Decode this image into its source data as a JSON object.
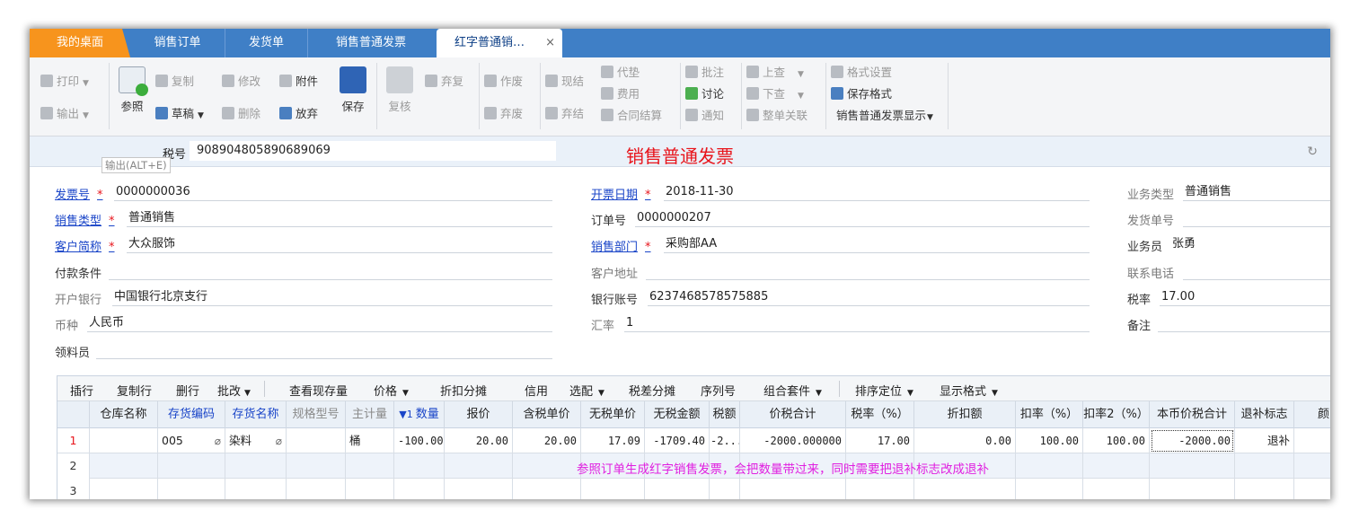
{
  "tabs": [
    {
      "label": "我的桌面"
    },
    {
      "label": "销售订单"
    },
    {
      "label": "发货单"
    },
    {
      "label": "销售普通发票"
    },
    {
      "label": "红字普通销…",
      "close": "×"
    }
  ],
  "toolbar": {
    "print": "打印",
    "export": "输出",
    "reference": "参照",
    "copy": "复制",
    "draft": "草稿",
    "modify": "修改",
    "delete": "删除",
    "attach": "附件",
    "discard": "放弃",
    "save": "保存",
    "review": "复核",
    "redo": "弃复",
    "void": "作废",
    "unvoid": "弃废",
    "cash": "现结",
    "uncash": "弃结",
    "advance": "代垫",
    "fee": "费用",
    "contract": "合同结算",
    "annotate": "批注",
    "discuss": "讨论",
    "notify": "通知",
    "up": "上查",
    "down": "下查",
    "link": "整单关联",
    "format_settings": "格式设置",
    "save_format": "保存格式",
    "display": "销售普通发票显示"
  },
  "header": {
    "tax_label": "税号",
    "tax_value": "908904805890689069",
    "title": "销售普通发票",
    "tooltip": "输出(ALT+E)",
    "refresh": "↻"
  },
  "form": {
    "invoice_no_label": "发票号",
    "invoice_no": "0000000036",
    "sale_type_label": "销售类型",
    "sale_type": "普通销售",
    "customer_label": "客户简称",
    "customer": "大众服饰",
    "payment_label": "付款条件",
    "payment": "",
    "bank_label": "开户银行",
    "bank": "中国银行北京支行",
    "currency_label": "币种",
    "currency": "人民币",
    "receiver_label": "领料员",
    "receiver": "",
    "date_label": "开票日期",
    "date": "2018-11-30",
    "order_no_label": "订单号",
    "order_no": "0000000207",
    "dept_label": "销售部门",
    "dept": "采购部AA",
    "address_label": "客户地址",
    "address": "",
    "account_label": "银行账号",
    "account": "6237468578575885",
    "rate_label": "汇率",
    "rate": "1",
    "biz_type_label": "业务类型",
    "biz_type": "普通销售",
    "delivery_no_label": "发货单号",
    "delivery_no": "",
    "salesman_label": "业务员",
    "salesman": "张勇",
    "phone_label": "联系电话",
    "phone": "",
    "tax_rate_label": "税率",
    "tax_rate": "17.00",
    "remark_label": "备注",
    "remark": "",
    "required_mark": "*"
  },
  "grid_toolbar": {
    "insert": "插行",
    "copy_row": "复制行",
    "delete_row": "删行",
    "batch": "批改",
    "stock": "查看现存量",
    "price": "价格",
    "discount_split": "折扣分摊",
    "credit": "信用",
    "match": "选配",
    "tax_split": "税差分摊",
    "serial": "序列号",
    "combo": "组合套件",
    "sort": "排序定位",
    "display_format": "显示格式"
  },
  "columns": [
    "仓库名称",
    "存货编码",
    "存货名称",
    "规格型号",
    "主计量",
    "数量",
    "报价",
    "含税单价",
    "无税单价",
    "无税金额",
    "税额",
    "价税合计",
    "税率（%）",
    "折扣额",
    "扣率（%）",
    "扣率2（%）",
    "本币价税合计",
    "退补标志",
    "颜"
  ],
  "rows": [
    {
      "no": "1",
      "warehouse": "",
      "code": "005",
      "name": "染料",
      "spec": "",
      "unit": "桶",
      "qty": "-100.00",
      "quote": "20.00",
      "tax_price": "20.00",
      "notax_price": "17.09",
      "notax_amount": "-1709.40",
      "tax": "-2...",
      "total": "-2000.000000",
      "tax_rate": "17.00",
      "discount": "0.00",
      "rate1": "100.00",
      "rate2": "100.00",
      "local_total": "-2000.00",
      "flag": "退补"
    },
    {
      "no": "2"
    },
    {
      "no": "3"
    }
  ],
  "note": "参照订单生成红字销售发票，会把数量带过来，同时需要把退补标志改成退补"
}
